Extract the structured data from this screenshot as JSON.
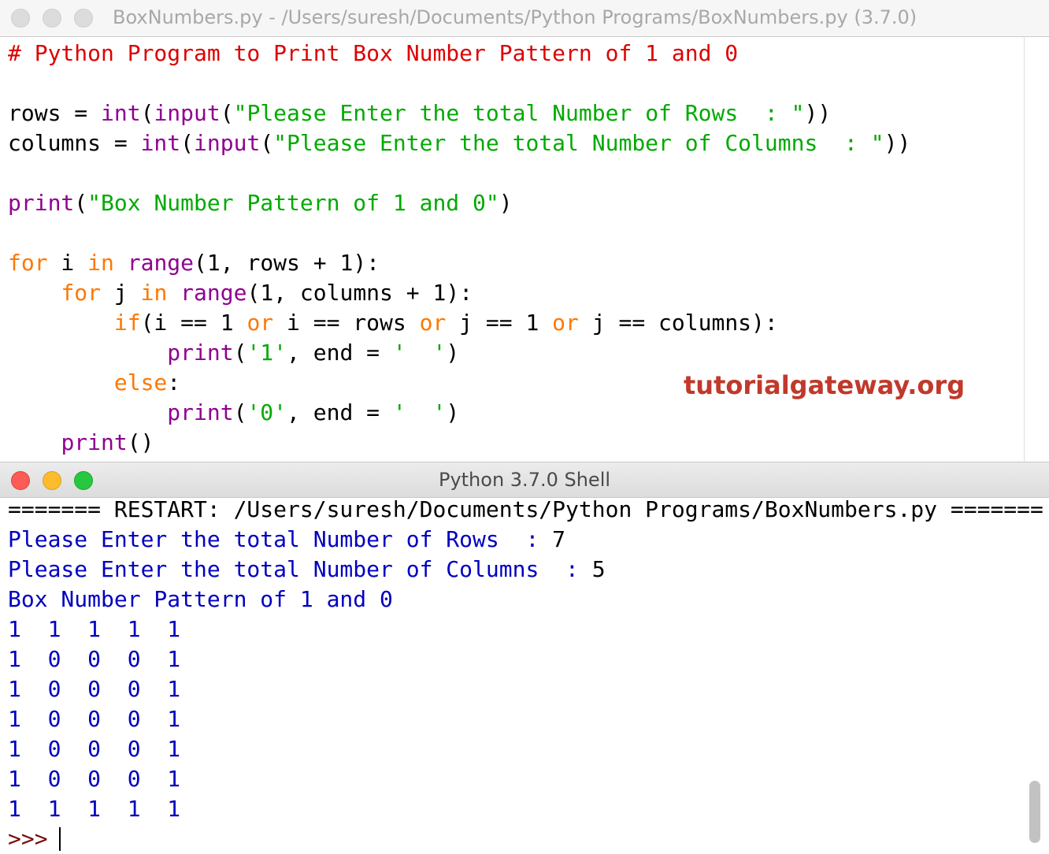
{
  "editor": {
    "title": "BoxNumbers.py - /Users/suresh/Documents/Python Programs/BoxNumbers.py (3.7.0)",
    "code_lines": [
      [
        {
          "t": "# Python Program to Print Box Number Pattern of 1 and 0",
          "c": "comment"
        }
      ],
      [],
      [
        {
          "t": "rows = ",
          "c": "plain"
        },
        {
          "t": "int",
          "c": "builtin"
        },
        {
          "t": "(",
          "c": "plain"
        },
        {
          "t": "input",
          "c": "builtin"
        },
        {
          "t": "(",
          "c": "plain"
        },
        {
          "t": "\"Please Enter the total Number of Rows  : \"",
          "c": "str"
        },
        {
          "t": "))",
          "c": "plain"
        }
      ],
      [
        {
          "t": "columns = ",
          "c": "plain"
        },
        {
          "t": "int",
          "c": "builtin"
        },
        {
          "t": "(",
          "c": "plain"
        },
        {
          "t": "input",
          "c": "builtin"
        },
        {
          "t": "(",
          "c": "plain"
        },
        {
          "t": "\"Please Enter the total Number of Columns  : \"",
          "c": "str"
        },
        {
          "t": "))",
          "c": "plain"
        }
      ],
      [],
      [
        {
          "t": "print",
          "c": "builtin"
        },
        {
          "t": "(",
          "c": "plain"
        },
        {
          "t": "\"Box Number Pattern of 1 and 0\"",
          "c": "str"
        },
        {
          "t": ")",
          "c": "plain"
        }
      ],
      [],
      [
        {
          "t": "for",
          "c": "kw"
        },
        {
          "t": " i ",
          "c": "plain"
        },
        {
          "t": "in",
          "c": "kw"
        },
        {
          "t": " ",
          "c": "plain"
        },
        {
          "t": "range",
          "c": "builtin"
        },
        {
          "t": "(1, rows + 1):",
          "c": "plain"
        }
      ],
      [
        {
          "t": "    ",
          "c": "plain"
        },
        {
          "t": "for",
          "c": "kw"
        },
        {
          "t": " j ",
          "c": "plain"
        },
        {
          "t": "in",
          "c": "kw"
        },
        {
          "t": " ",
          "c": "plain"
        },
        {
          "t": "range",
          "c": "builtin"
        },
        {
          "t": "(1, columns + 1):",
          "c": "plain"
        }
      ],
      [
        {
          "t": "        ",
          "c": "plain"
        },
        {
          "t": "if",
          "c": "kw"
        },
        {
          "t": "(i == 1 ",
          "c": "plain"
        },
        {
          "t": "or",
          "c": "kw"
        },
        {
          "t": " i == rows ",
          "c": "plain"
        },
        {
          "t": "or",
          "c": "kw"
        },
        {
          "t": " j == 1 ",
          "c": "plain"
        },
        {
          "t": "or",
          "c": "kw"
        },
        {
          "t": " j == columns):",
          "c": "plain"
        }
      ],
      [
        {
          "t": "            ",
          "c": "plain"
        },
        {
          "t": "print",
          "c": "builtin"
        },
        {
          "t": "(",
          "c": "plain"
        },
        {
          "t": "'1'",
          "c": "str"
        },
        {
          "t": ", end = ",
          "c": "plain"
        },
        {
          "t": "'  '",
          "c": "str"
        },
        {
          "t": ")",
          "c": "plain"
        }
      ],
      [
        {
          "t": "        ",
          "c": "plain"
        },
        {
          "t": "else",
          "c": "kw"
        },
        {
          "t": ":",
          "c": "plain"
        }
      ],
      [
        {
          "t": "            ",
          "c": "plain"
        },
        {
          "t": "print",
          "c": "builtin"
        },
        {
          "t": "(",
          "c": "plain"
        },
        {
          "t": "'0'",
          "c": "str"
        },
        {
          "t": ", end = ",
          "c": "plain"
        },
        {
          "t": "'  '",
          "c": "str"
        },
        {
          "t": ")",
          "c": "plain"
        }
      ],
      [
        {
          "t": "    ",
          "c": "plain"
        },
        {
          "t": "print",
          "c": "builtin"
        },
        {
          "t": "()",
          "c": "plain"
        }
      ]
    ]
  },
  "watermark": "tutorialgateway.org",
  "shell": {
    "title": "Python 3.7.0 Shell",
    "restart_line": "======= RESTART: /Users/suresh/Documents/Python Programs/BoxNumbers.py =======",
    "prompt_rows_label": "Please Enter the total Number of Rows  : ",
    "rows_value": "7",
    "prompt_cols_label": "Please Enter the total Number of Columns  : ",
    "cols_value": "5",
    "pattern_title": "Box Number Pattern of 1 and 0",
    "output_rows": [
      "1  1  1  1  1",
      "1  0  0  0  1",
      "1  0  0  0  1",
      "1  0  0  0  1",
      "1  0  0  0  1",
      "1  0  0  0  1",
      "1  1  1  1  1"
    ],
    "prompt": ">>>"
  },
  "colors": {
    "comment": "#dd0000",
    "keyword": "#ff7700",
    "builtin": "#900090",
    "string": "#00aa00",
    "shell_output": "#0000c0",
    "watermark": "#c0392b"
  }
}
